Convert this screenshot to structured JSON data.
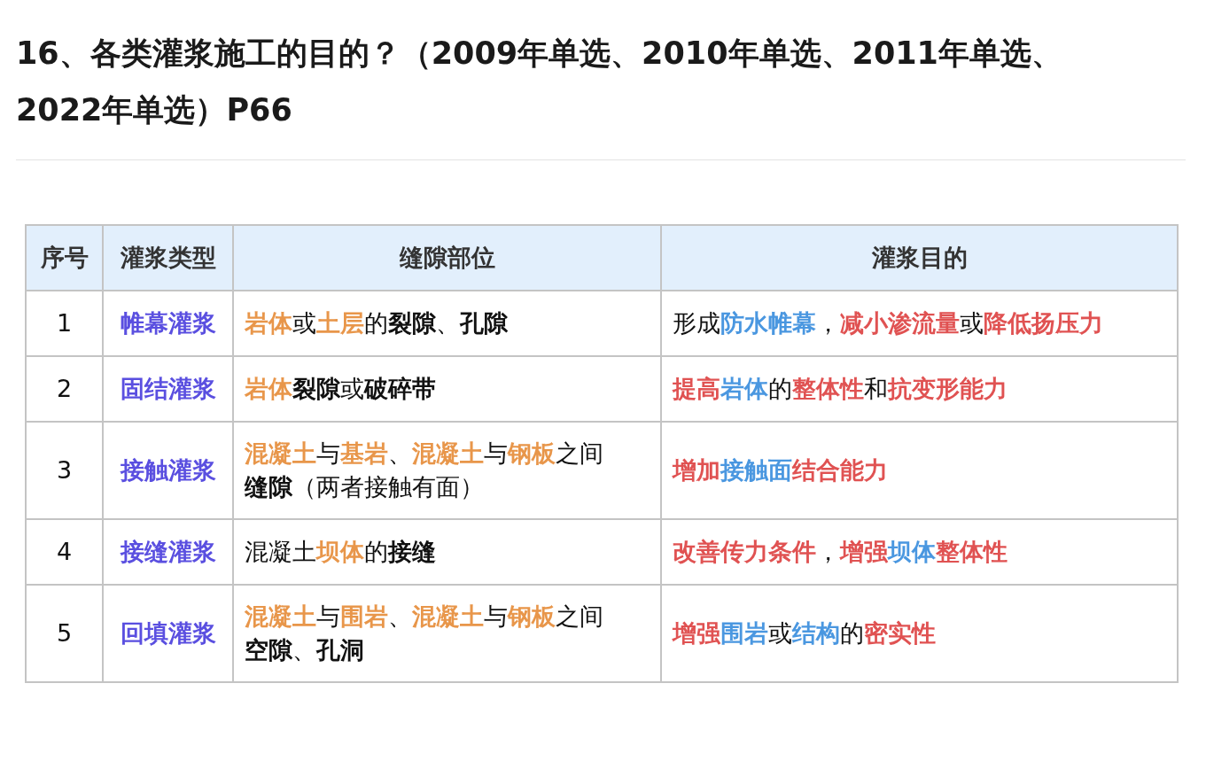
{
  "title": "16、各类灌浆施工的目的？（2009年单选、2010年单选、2011年单选、2022年单选）P66",
  "table": {
    "columns": [
      "序号",
      "灌浆类型",
      "缝隙部位",
      "灌浆目的"
    ],
    "rows": [
      {
        "index": "1",
        "type": "帷幕灌浆",
        "location": [
          {
            "text": "岩体",
            "color": "#e8964a",
            "bold": true
          },
          {
            "text": "或",
            "bold": false
          },
          {
            "text": "土层",
            "color": "#e8964a",
            "bold": true
          },
          {
            "text": "的",
            "bold": false
          },
          {
            "text": "裂隙",
            "bold": true
          },
          {
            "text": "、",
            "bold": false
          },
          {
            "text": "孔隙",
            "bold": true
          }
        ],
        "purpose": [
          {
            "text": "形成",
            "bold": false
          },
          {
            "text": "防水帷幕",
            "color": "#4a97e0",
            "bold": true
          },
          {
            "text": "，",
            "bold": false
          },
          {
            "text": "减小渗流量",
            "color": "#e05252",
            "bold": true
          },
          {
            "text": "或",
            "bold": false
          },
          {
            "text": "降低扬压力",
            "color": "#e05252",
            "bold": true
          }
        ]
      },
      {
        "index": "2",
        "type": "固结灌浆",
        "location": [
          {
            "text": "岩体",
            "color": "#e8964a",
            "bold": true
          },
          {
            "text": "裂隙",
            "bold": true
          },
          {
            "text": "或",
            "bold": false
          },
          {
            "text": "破碎带",
            "bold": true
          }
        ],
        "purpose": [
          {
            "text": "提高",
            "color": "#e05252",
            "bold": true
          },
          {
            "text": "岩体",
            "color": "#4a97e0",
            "bold": true
          },
          {
            "text": "的",
            "bold": false
          },
          {
            "text": "整体性",
            "color": "#e05252",
            "bold": true
          },
          {
            "text": "和",
            "bold": false
          },
          {
            "text": "抗变形能力",
            "color": "#e05252",
            "bold": true
          }
        ]
      },
      {
        "index": "3",
        "type": "接触灌浆",
        "location": [
          {
            "text": "混凝土",
            "color": "#e8964a",
            "bold": true
          },
          {
            "text": "与",
            "bold": false
          },
          {
            "text": "基岩",
            "color": "#e8964a",
            "bold": true
          },
          {
            "text": "、",
            "bold": false
          },
          {
            "text": "混凝土",
            "color": "#e8964a",
            "bold": true
          },
          {
            "text": "与",
            "bold": false
          },
          {
            "text": "钢板",
            "color": "#e8964a",
            "bold": true
          },
          {
            "text": "之间",
            "bold": false
          },
          {
            "text": "缝隙",
            "bold": true
          },
          {
            "text": "（两者接触有面）",
            "bold": false
          }
        ],
        "purpose": [
          {
            "text": "增加",
            "color": "#e05252",
            "bold": true
          },
          {
            "text": "接触面",
            "color": "#4a97e0",
            "bold": true
          },
          {
            "text": "结合能力",
            "color": "#e05252",
            "bold": true
          }
        ]
      },
      {
        "index": "4",
        "type": "接缝灌浆",
        "location": [
          {
            "text": "混凝土",
            "bold": false
          },
          {
            "text": "坝体",
            "color": "#e8964a",
            "bold": true
          },
          {
            "text": "的",
            "bold": false
          },
          {
            "text": "接缝",
            "bold": true
          }
        ],
        "purpose": [
          {
            "text": "改善传力条件",
            "color": "#e05252",
            "bold": true
          },
          {
            "text": "，",
            "bold": false
          },
          {
            "text": "增强",
            "color": "#e05252",
            "bold": true
          },
          {
            "text": "坝体",
            "color": "#4a97e0",
            "bold": true
          },
          {
            "text": "整体性",
            "color": "#e05252",
            "bold": true
          }
        ]
      },
      {
        "index": "5",
        "type": "回填灌浆",
        "location": [
          {
            "text": "混凝土",
            "color": "#e8964a",
            "bold": true
          },
          {
            "text": "与",
            "bold": false
          },
          {
            "text": "围岩",
            "color": "#e8964a",
            "bold": true
          },
          {
            "text": "、",
            "bold": false
          },
          {
            "text": "混凝土",
            "color": "#e8964a",
            "bold": true
          },
          {
            "text": "与",
            "bold": false
          },
          {
            "text": "钢板",
            "color": "#e8964a",
            "bold": true
          },
          {
            "text": "之间",
            "bold": false
          },
          {
            "text": "空隙",
            "bold": true
          },
          {
            "text": "、",
            "bold": false
          },
          {
            "text": "孔洞",
            "bold": true
          }
        ],
        "purpose": [
          {
            "text": "增强",
            "color": "#e05252",
            "bold": true
          },
          {
            "text": "围岩",
            "color": "#4a97e0",
            "bold": true
          },
          {
            "text": "或",
            "bold": false
          },
          {
            "text": "结构",
            "color": "#4a97e0",
            "bold": true
          },
          {
            "text": "的",
            "bold": false
          },
          {
            "text": "密实性",
            "color": "#e05252",
            "bold": true
          }
        ]
      }
    ]
  }
}
